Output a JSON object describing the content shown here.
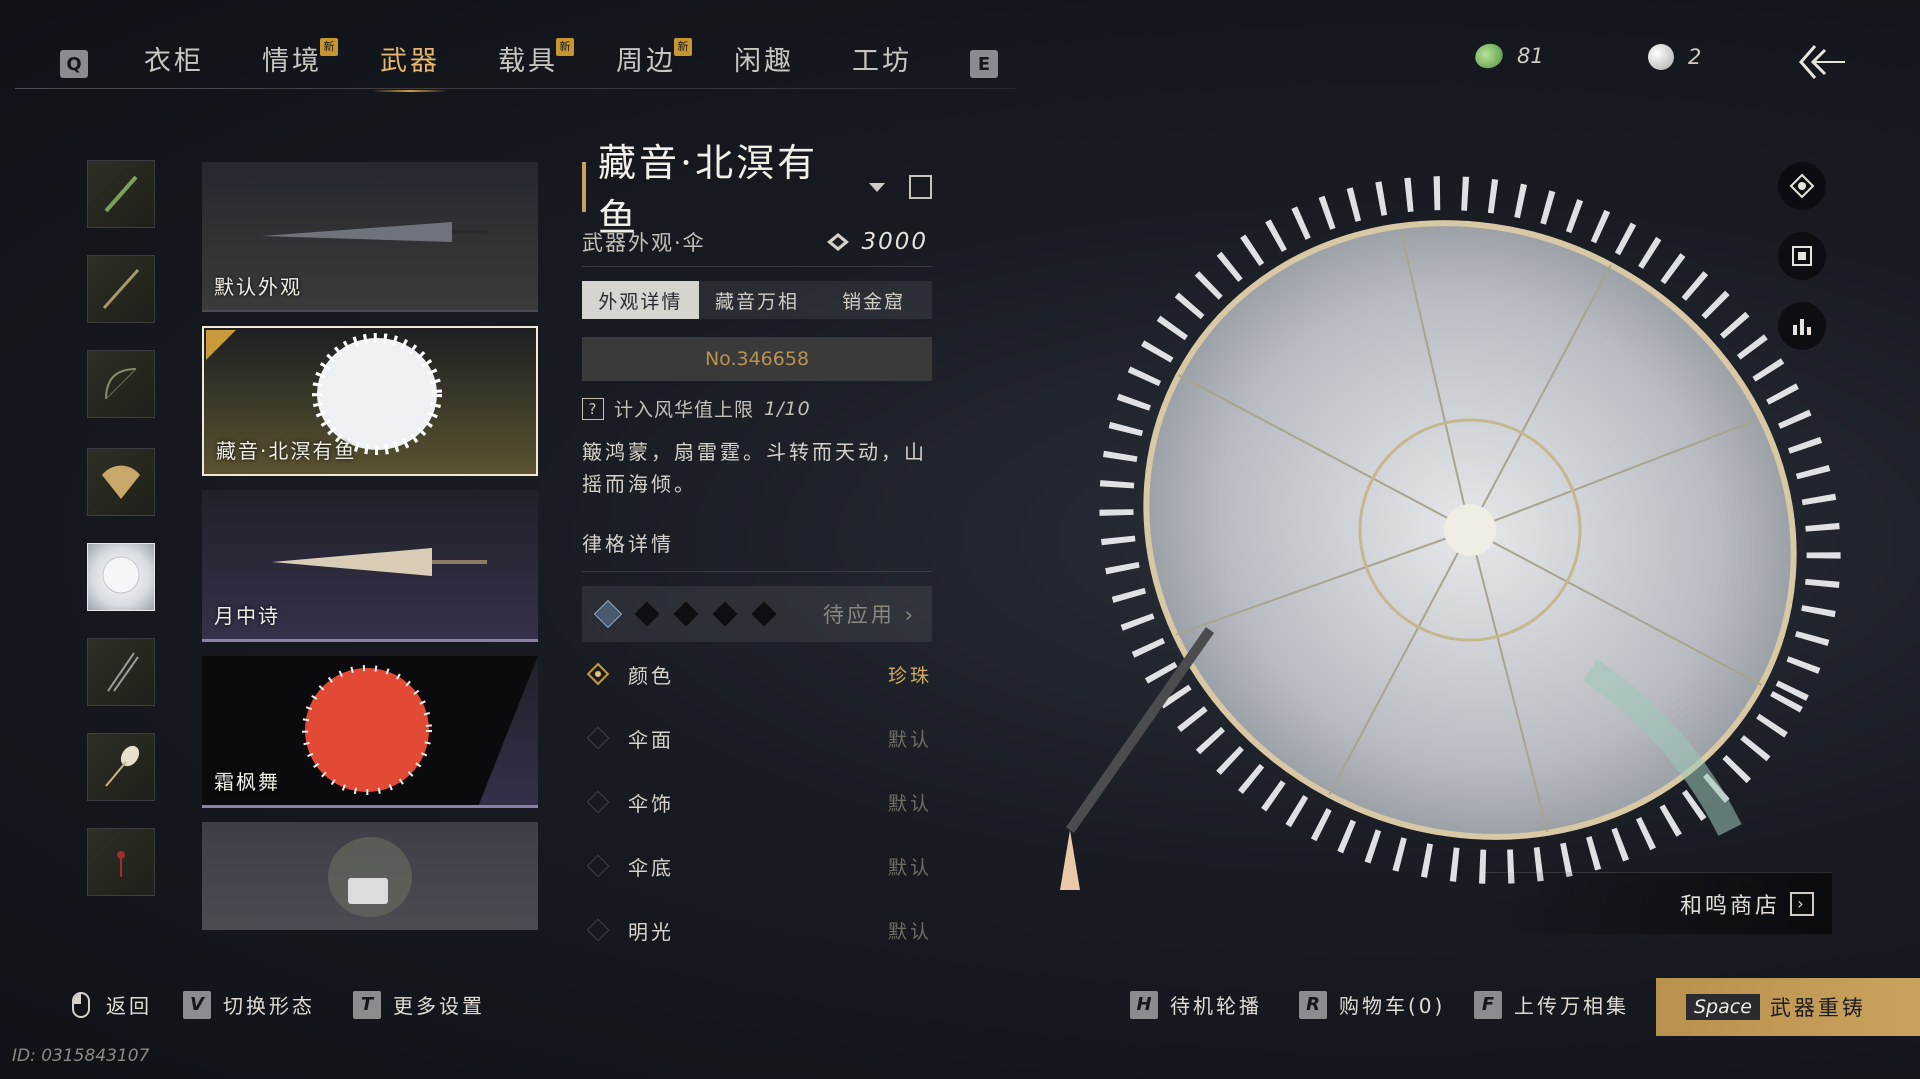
{
  "nav": {
    "key_left": "Q",
    "key_right": "E",
    "tabs": [
      {
        "label": "衣柜",
        "badge": ""
      },
      {
        "label": "情境",
        "badge": "新"
      },
      {
        "label": "武器",
        "badge": ""
      },
      {
        "label": "载具",
        "badge": "新"
      },
      {
        "label": "周边",
        "badge": "新"
      },
      {
        "label": "闲趣",
        "badge": ""
      },
      {
        "label": "工坊",
        "badge": ""
      }
    ],
    "active_tab": "武器"
  },
  "currency": {
    "jade": "81",
    "pearl": "2"
  },
  "thumbnails": [
    "竹笛",
    "长剑",
    "弓",
    "扇",
    "伞",
    "双刀",
    "拂尘",
    "饰物"
  ],
  "cards": [
    {
      "label": "默认外观"
    },
    {
      "label": "藏音·北溟有鱼",
      "selected": true
    },
    {
      "label": "月中诗"
    },
    {
      "label": "霜枫舞"
    },
    {
      "label": "",
      "locked": true
    }
  ],
  "detail": {
    "title": "藏音·北溟有鱼",
    "subtitle": "武器外观·伞",
    "price": "3000",
    "tabs": [
      "外观详情",
      "藏音万相",
      "销金窟"
    ],
    "active_tab": "外观详情",
    "serial": "No.346658",
    "hint_mark": "?",
    "hint": "计入风华值上限",
    "hint_count": "1/10",
    "description": "簸鸿蒙，扇雷霆。斗转而天动，山摇而海倾。",
    "section": "律格详情",
    "slots_label": "待应用 ›",
    "options": [
      {
        "label": "颜色",
        "value": "珍珠"
      },
      {
        "label": "伞面",
        "value": "默认"
      },
      {
        "label": "伞饰",
        "value": "默认"
      },
      {
        "label": "伞底",
        "value": "默认"
      },
      {
        "label": "明光",
        "value": "默认"
      }
    ]
  },
  "shop": {
    "label": "和鸣商店"
  },
  "bottom": {
    "back": "返回",
    "switch_key": "V",
    "switch": "切换形态",
    "more_key": "T",
    "more": "更多设置",
    "idle_key": "H",
    "idle": "待机轮播",
    "cart_key": "R",
    "cart": "购物车(0)",
    "upload_key": "F",
    "upload": "上传万相集",
    "reforge_key": "Space",
    "reforge": "武器重铸"
  },
  "uid": "ID: 0315843107",
  "colors": {
    "accent": "#e4b56a",
    "gold": "#c8a05a",
    "reforge": "#c9a35e"
  }
}
